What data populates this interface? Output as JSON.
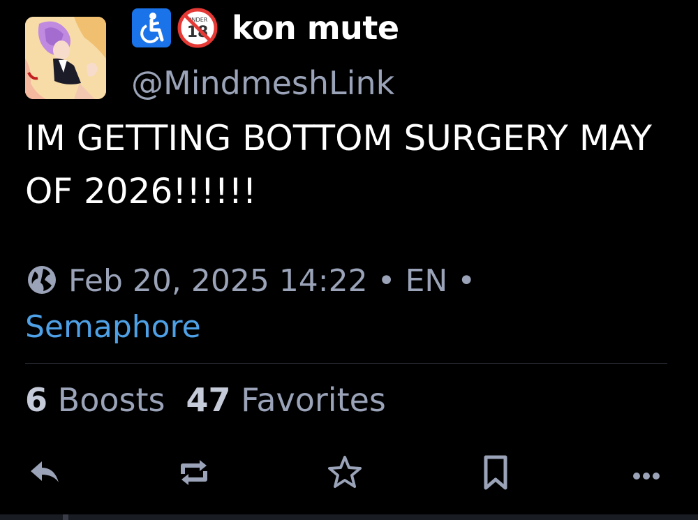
{
  "post": {
    "author": {
      "display_name": "kon mute",
      "handle": "@MindmeshLink",
      "badges": [
        "wheelchair-icon",
        "no-under-18-icon"
      ]
    },
    "text": "IM GETTING BOTTOM SURGERY MAY OF 2026!!!!!!",
    "meta": {
      "date": "Feb 20, 2025 14:22",
      "separator": "•",
      "language": "EN",
      "app": "Semaphore"
    },
    "stats": {
      "boosts_count": "6",
      "boosts_label": "Boosts",
      "favorites_count": "47",
      "favorites_label": "Favorites"
    },
    "actions": [
      "reply-icon",
      "boost-icon",
      "favorite-icon",
      "bookmark-icon",
      "more-icon"
    ]
  },
  "colors": {
    "background": "#000000",
    "text": "#ffffff",
    "muted": "#9aa3b8",
    "link": "#4ea1e6",
    "badge_blue": "#1a73e8",
    "badge_red": "#e53935"
  }
}
